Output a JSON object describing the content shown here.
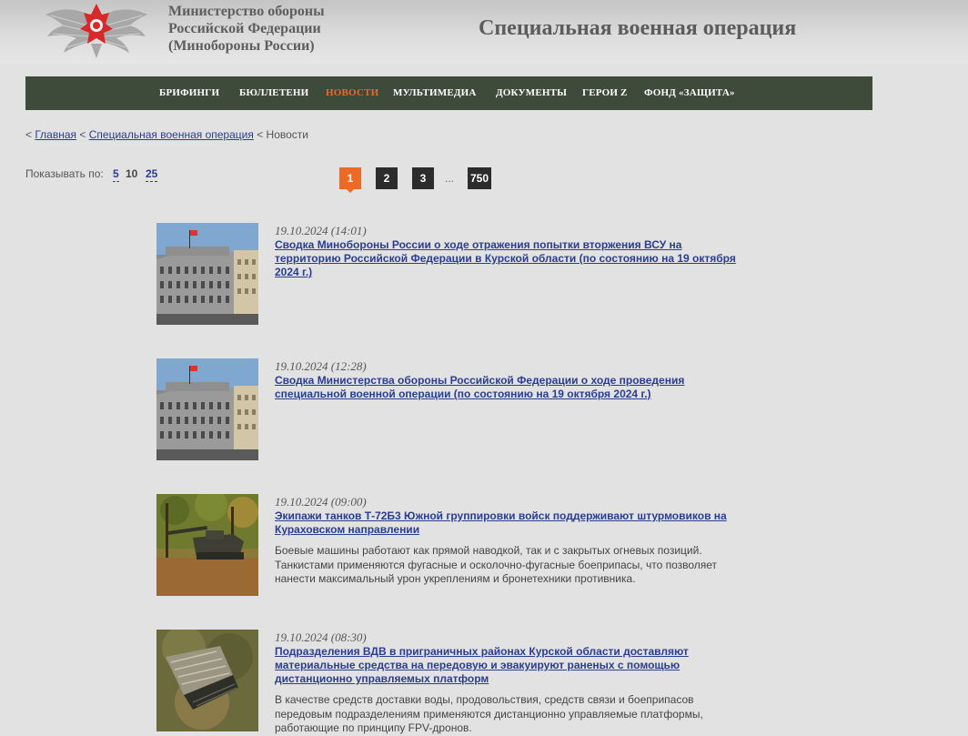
{
  "header": {
    "ministry_line1": "Министерство обороны",
    "ministry_line2": "Российской Федерации",
    "ministry_line3": "(Минобороны России)",
    "site_title": "Специальная военная операция"
  },
  "nav": {
    "items": [
      {
        "label": "БРИФИНГИ"
      },
      {
        "label": "БЮЛЛЕТЕНИ"
      },
      {
        "label": "НОВОСТИ"
      },
      {
        "label": "МУЛЬТИМЕДИА"
      },
      {
        "label": "ДОКУМЕНТЫ"
      },
      {
        "label": "ГЕРОИ Z"
      },
      {
        "label": "ФОНД «ЗАЩИТА»"
      }
    ]
  },
  "breadcrumb": {
    "sep": "<",
    "home": "Главная",
    "section": "Специальная военная операция",
    "current": "Новости"
  },
  "perpage": {
    "label": "Показывать по:",
    "options": [
      "5",
      "10",
      "25"
    ],
    "selected": "10"
  },
  "pagination": {
    "pages": [
      "1",
      "2",
      "3"
    ],
    "ellipsis": "...",
    "last": "750",
    "current": "1"
  },
  "news": [
    {
      "date": "19.10.2024 (14:01)",
      "title": "Сводка Минобороны России о ходе отражения попытки вторжения ВСУ на территорию Российской Федерации в Курской области (по состоянию на 19 октября 2024 г.)",
      "text": ""
    },
    {
      "date": "19.10.2024 (12:28)",
      "title": "Сводка Министерства обороны Российской Федерации о ходе проведения специальной военной операции (по состоянию на 19 октября 2024 г.)",
      "text": ""
    },
    {
      "date": "19.10.2024 (09:00)",
      "title": "Экипажи танков Т-72Б3 Южной группировки войск поддерживают штурмовиков на Кураховском направлении",
      "text": "Боевые машины работают как прямой наводкой, так и с закрытых огневых позиций. Танкистами применяются фугасные и осколочно-фугасные боеприпасы, что позволяет нанести максимальный урон укреплениям и бронетехники противника."
    },
    {
      "date": "19.10.2024 (08:30)",
      "title": "Подразделения ВДВ в приграничных районах Курской области доставляют материальные средства на передовую и эвакуируют раненых с помощью дистанционно управляемых платформ",
      "text": "В качестве средств доставки воды, продовольствия, средств связи и боеприпасов передовым подразделениям применяются дистанционно управляемые платформы, работающие по принципу FPV-дронов."
    }
  ],
  "colors": {
    "nav_bg": "#3e4b3a",
    "accent": "#ec6a25",
    "link": "#2a3d92",
    "page_bg": "#e2e2e2"
  },
  "icons": {
    "emblem": "double-headed-eagle-emblem"
  }
}
